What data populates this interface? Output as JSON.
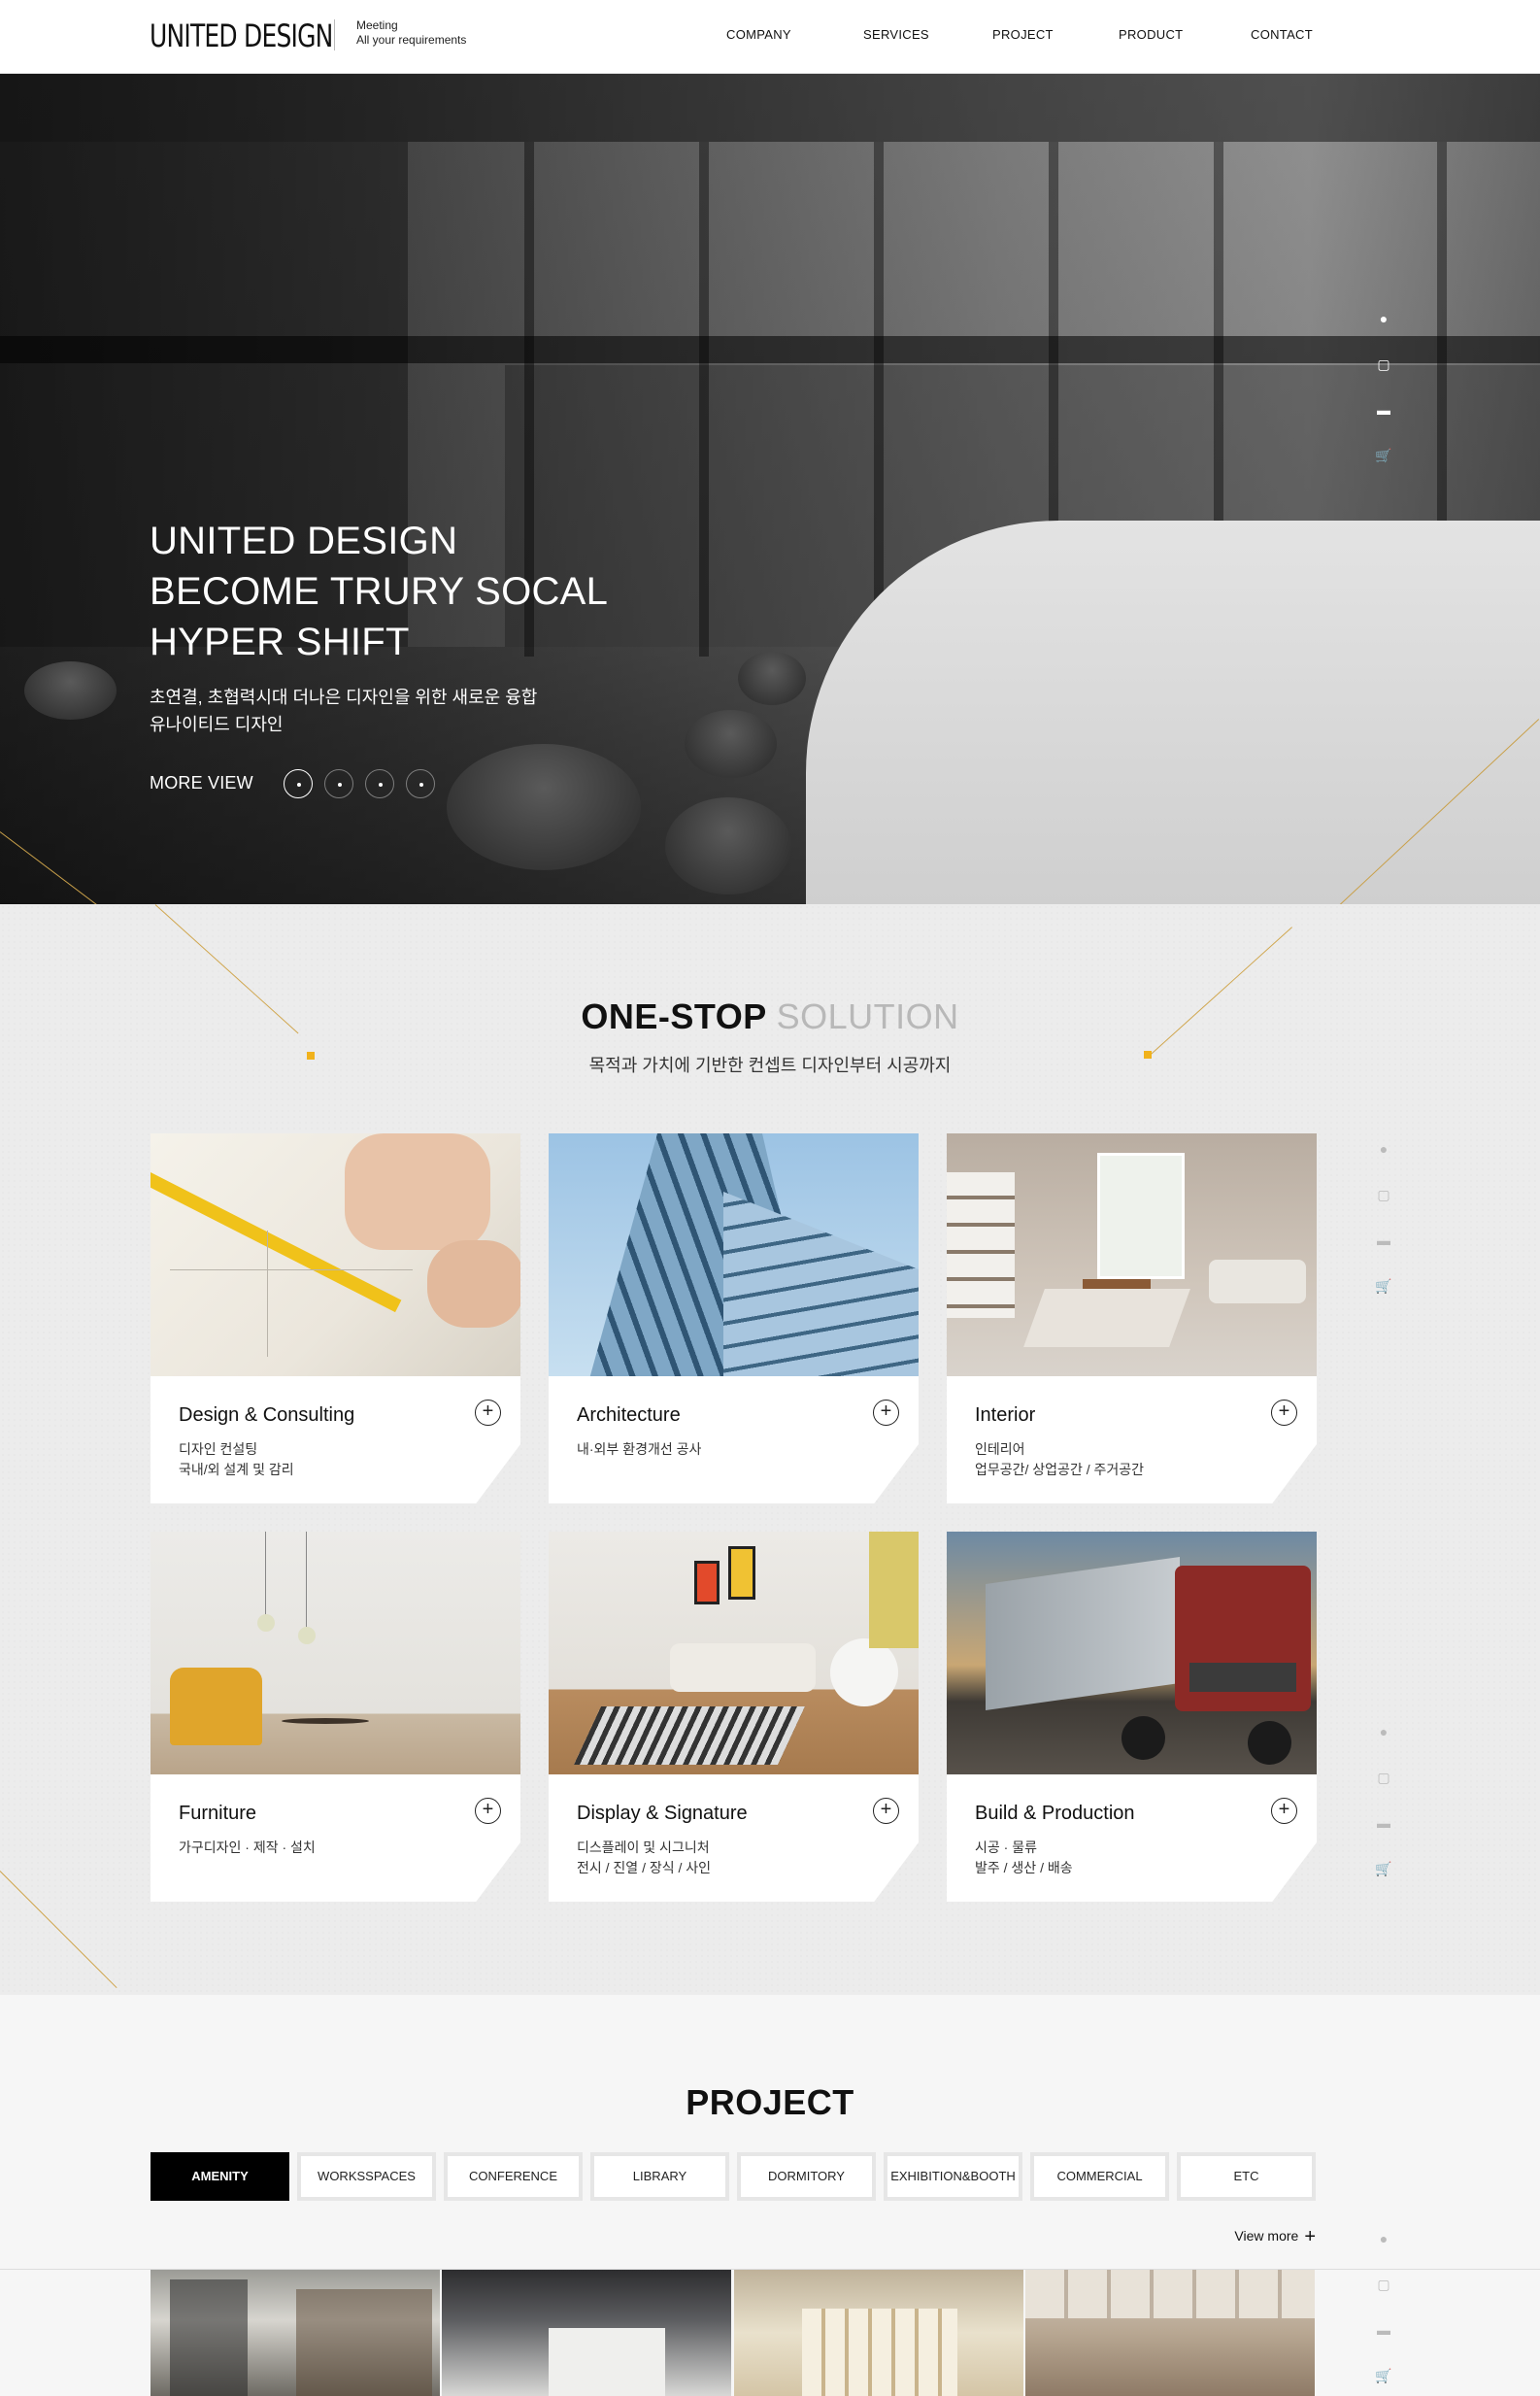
{
  "header": {
    "logo": "UNITED DESIGN",
    "tagline_line1": "Meeting",
    "tagline_line2": "All your requirements",
    "nav": [
      "COMPANY",
      "SERVICES",
      "PROJECT",
      "PRODUCT",
      "CONTACT"
    ]
  },
  "hero": {
    "title_line1": "UNITED DESIGN",
    "title_line2": "BECOME TRURY SOCAL",
    "title_line3": "HYPER SHIFT",
    "sub_line1": "초연결, 초협력시대 더나은 디자인을 위한 새로운 융합",
    "sub_line2": "유나이티드 디자인",
    "more_view": "MORE VIEW",
    "slide_count": 4,
    "active_slide": 1
  },
  "side_icons": [
    "blog-icon",
    "instagram-icon",
    "talk-icon",
    "cart-icon"
  ],
  "solution": {
    "title_bold": "ONE-STOP",
    "title_light": "SOLUTION",
    "subtitle": "목적과 가치에 기반한 컨셉트 디자인부터 시공까지",
    "cards": [
      {
        "title": "Design & Consulting",
        "desc": "디자인 컨설팅\n국내/외 설계 및 감리"
      },
      {
        "title": "Architecture",
        "desc": "내·외부 환경개선 공사"
      },
      {
        "title": "Interior",
        "desc": "인테리어\n업무공간/ 상업공간 / 주거공간"
      },
      {
        "title": "Furniture",
        "desc": "가구디자인 · 제작 · 설치"
      },
      {
        "title": "Display & Signature",
        "desc": "디스플레이 및 시그니처\n전시 / 진열 / 장식 / 사인"
      },
      {
        "title": "Build & Production",
        "desc": "시공 · 물류\n발주 / 생산 / 배송"
      }
    ],
    "plus": "+"
  },
  "project": {
    "title": "PROJECT",
    "tabs": [
      "AMENITY",
      "WORKSSPACES",
      "CONFERENCE",
      "LIBRARY",
      "DORMITORY",
      "EXHIBITION&BOOTH",
      "COMMERCIAL",
      "ETC"
    ],
    "active_tab": "AMENITY",
    "view_more": "View more",
    "view_more_icon": "+"
  },
  "colors": {
    "accent_gold": "#d0a64e",
    "accent_yellow": "#f1b21c",
    "tab_active": "#000000"
  }
}
